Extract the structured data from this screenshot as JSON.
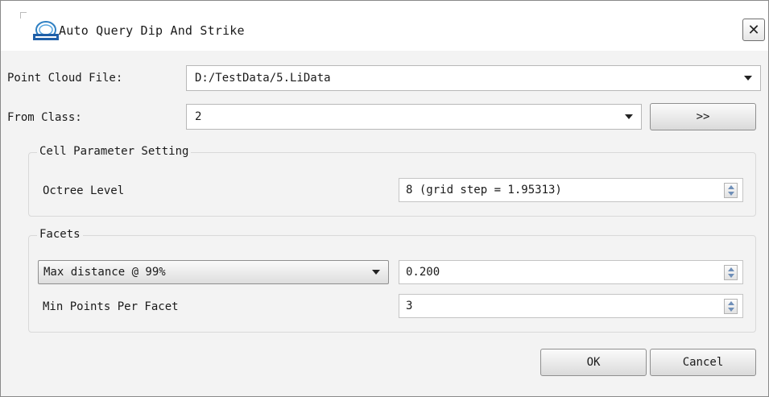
{
  "window": {
    "title": "Auto Query Dip And Strike",
    "close_label": "✕"
  },
  "point_cloud": {
    "label": "Point Cloud File:",
    "value": "D:/TestData/5.LiData"
  },
  "from_class": {
    "label": "From Class:",
    "value": "2",
    "more_button_label": ">>"
  },
  "cell_group": {
    "title": "Cell Parameter Setting",
    "octree_label": "Octree Level",
    "octree_value": "8 (grid step = 1.95313)"
  },
  "facets_group": {
    "title": "Facets",
    "mode_selected": "Max distance @ 99%",
    "mode_value": "0.200",
    "min_points_label": "Min Points Per Facet",
    "min_points_value": "3"
  },
  "footer": {
    "ok_label": "OK",
    "cancel_label": "Cancel"
  }
}
